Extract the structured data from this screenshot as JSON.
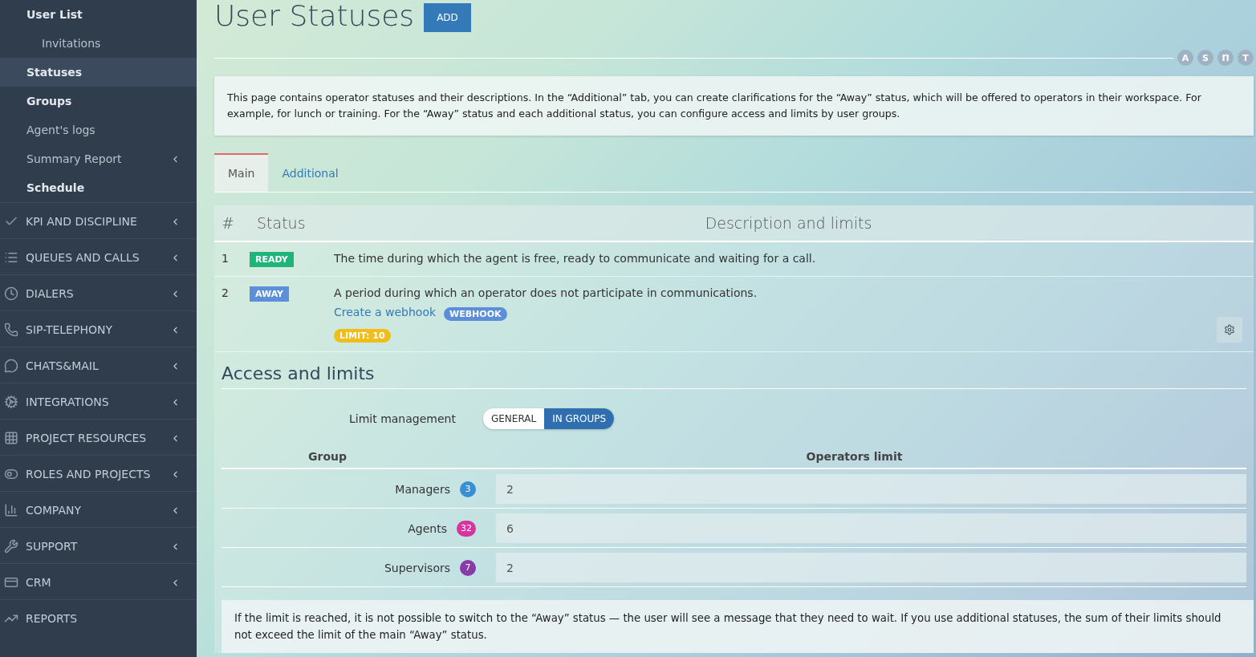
{
  "sidebar": {
    "sub_items": [
      {
        "label": "User List",
        "bold": true,
        "selected": false,
        "indented": false,
        "expandable": false
      },
      {
        "label": "Invitations",
        "bold": false,
        "selected": false,
        "indented": true,
        "expandable": false
      },
      {
        "label": "Statuses",
        "bold": true,
        "selected": true,
        "indented": false,
        "expandable": false
      },
      {
        "label": "Groups",
        "bold": true,
        "selected": false,
        "indented": false,
        "expandable": false
      },
      {
        "label": "Agent's logs",
        "bold": false,
        "selected": false,
        "indented": false,
        "expandable": false
      },
      {
        "label": "Summary Report",
        "bold": false,
        "selected": false,
        "indented": false,
        "expandable": true
      },
      {
        "label": "Schedule",
        "bold": true,
        "selected": false,
        "indented": false,
        "expandable": false
      }
    ],
    "sections": [
      {
        "label": "KPI AND DISCIPLINE",
        "expandable": true
      },
      {
        "label": "QUEUES AND CALLS",
        "expandable": true
      },
      {
        "label": "DIALERS",
        "expandable": true
      },
      {
        "label": "SIP-TELEPHONY",
        "expandable": true
      },
      {
        "label": "CHATS&MAIL",
        "expandable": true
      },
      {
        "label": "INTEGRATIONS",
        "expandable": true
      },
      {
        "label": "PROJECT RESOURCES",
        "expandable": true
      },
      {
        "label": "ROLES AND PROJECTS",
        "expandable": true
      },
      {
        "label": "COMPANY",
        "expandable": true
      },
      {
        "label": "SUPPORT",
        "expandable": true
      },
      {
        "label": "CRM",
        "expandable": true
      },
      {
        "label": "REPORTS",
        "expandable": false
      }
    ]
  },
  "header": {
    "title": "User Statuses",
    "add_button": "ADD",
    "languages": [
      "A",
      "S",
      "П",
      "T"
    ]
  },
  "info": "This page contains operator statuses and their descriptions. In the “Additional” tab, you can create clarifications for the “Away” status, which will be offered to operators in their workspace. For example, for lunch or training. For the “Away” status and each additional status, you can configure access and limits by user groups.",
  "tabs": [
    {
      "label": "Main",
      "selected": true
    },
    {
      "label": "Additional",
      "selected": false
    }
  ],
  "status_table": {
    "columns": [
      "#",
      "Status",
      "Description and limits"
    ],
    "rows": [
      {
        "number": "1",
        "status": "READY",
        "color": "#1fb57a",
        "description": "The time during which the agent is free, ready to communicate and waiting for a call."
      },
      {
        "number": "2",
        "status": "AWAY",
        "color": "#5b8fd9",
        "description": "A period during which an operator does not participate in communications.",
        "link": "Create a webhook",
        "tag": "WEBHOOK",
        "limit": "LIMIT: 10",
        "settings": true
      }
    ]
  },
  "access": {
    "title": "Access and limits",
    "limit_label": "Limit management",
    "modes": [
      {
        "label": "GENERAL",
        "selected": false
      },
      {
        "label": "IN GROUPS",
        "selected": true
      }
    ],
    "columns": [
      "Group",
      "Operators limit"
    ],
    "groups": [
      {
        "name": "Managers",
        "count": "3",
        "color": "#3a8ed6",
        "value": "2"
      },
      {
        "name": "Agents",
        "count": "32",
        "color": "#d6359f",
        "value": "6"
      },
      {
        "name": "Supervisors",
        "count": "7",
        "color": "#8a3aa8",
        "value": "2"
      }
    ],
    "note": "If the limit is reached, it is not possible to switch to the “Away” status — the user will see a message that they need to wait. If you use additional statuses, the sum of their limits should not exceed the limit of the main “Away” status."
  }
}
